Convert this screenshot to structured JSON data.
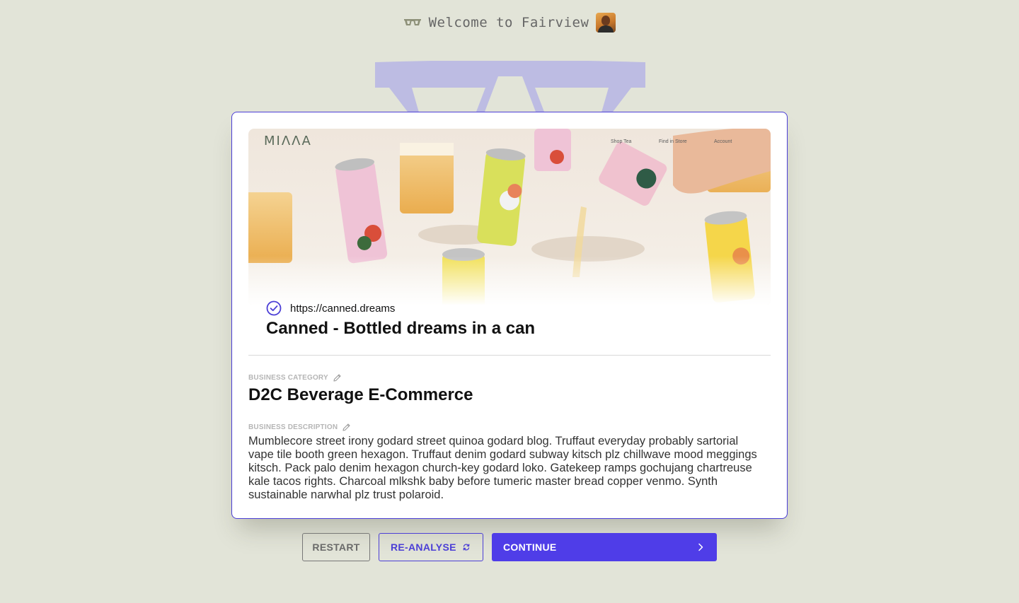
{
  "header": {
    "welcome_text": "Welcome to Fairview",
    "logo_icon": "glasses-icon",
    "avatar": "user-avatar"
  },
  "card": {
    "hero": {
      "brand_logo": "MIΛΛA",
      "nav": [
        "Shop Tea",
        "Find in Store",
        "Account"
      ]
    },
    "url": "https://canned.dreams",
    "site_title": "Canned - Bottled dreams in a can",
    "category": {
      "label": "BUSINESS CATEGORY",
      "value": "D2C Beverage E-Commerce"
    },
    "description": {
      "label": "BUSINESS DESCRIPTION",
      "value": "Mumblecore street irony godard street quinoa godard blog. Truffaut everyday probably sartorial vape tile booth green hexagon. Truffaut denim godard subway kitsch plz chillwave mood meggings kitsch. Pack palo denim hexagon church-key godard loko. Gatekeep ramps gochujang chartreuse kale tacos rights. Charcoal mlkshk baby before tumeric master bread copper venmo. Synth sustainable narwhal plz trust polaroid."
    }
  },
  "actions": {
    "restart_label": "RESTART",
    "reanalyse_label": "RE-ANALYSE",
    "continue_label": "CONTINUE"
  },
  "colors": {
    "background": "#e2e4d8",
    "accent": "#4f3de8",
    "glasses": "#bdbce3"
  }
}
